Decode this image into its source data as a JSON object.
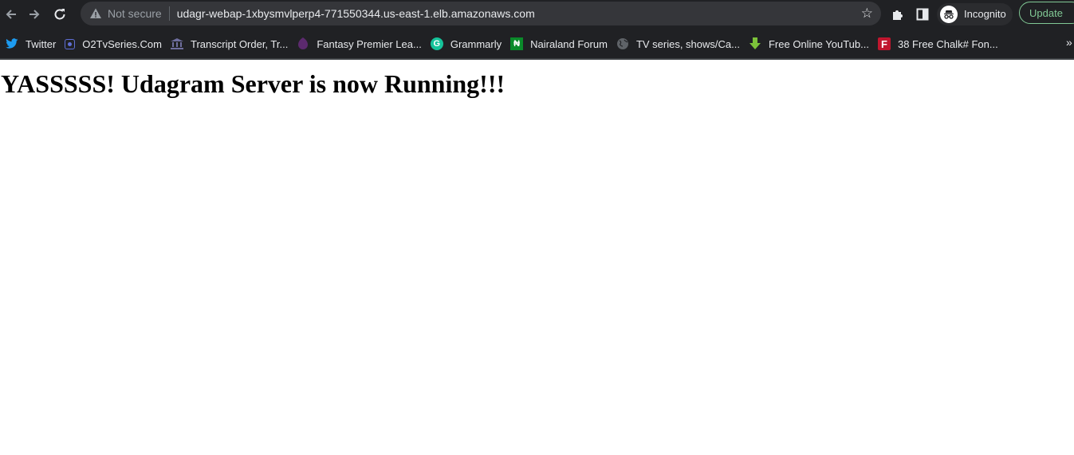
{
  "browser": {
    "address_bar": {
      "security_label": "Not secure",
      "url": "udagr-webap-1xbysmvlperp4-771550344.us-east-1.elb.amazonaws.com"
    },
    "profile_label": "Incognito",
    "update_label": "Update",
    "bookmarks": [
      {
        "label": "Twitter",
        "icon": "twitter-icon",
        "color": "#1d9bf0"
      },
      {
        "label": "O2TvSeries.Com",
        "icon": "o2tv-icon",
        "color": "#5f6fd6"
      },
      {
        "label": "Transcript Order, Tr...",
        "icon": "bank-icon",
        "color": "#6e6e9e"
      },
      {
        "label": "Fantasy Premier Lea...",
        "icon": "premier-league-icon",
        "color": "#5c2a6e"
      },
      {
        "label": "Grammarly",
        "icon": "grammarly-icon",
        "color": "#15c39a"
      },
      {
        "label": "Nairaland Forum",
        "icon": "nairaland-icon",
        "color": "#0a8a2a"
      },
      {
        "label": "TV series, shows/Ca...",
        "icon": "globe-icon",
        "color": "#5f6368"
      },
      {
        "label": "Free Online YouTub...",
        "icon": "download-arrow-icon",
        "color": "#7cc23a"
      },
      {
        "label": "38 Free Chalk# Fon...",
        "icon": "font-f-icon",
        "color": "#c0162e"
      }
    ],
    "bookmarks_overflow": "»"
  },
  "page": {
    "heading": "YASSSSS! Udagram Server is now Running!!!"
  }
}
